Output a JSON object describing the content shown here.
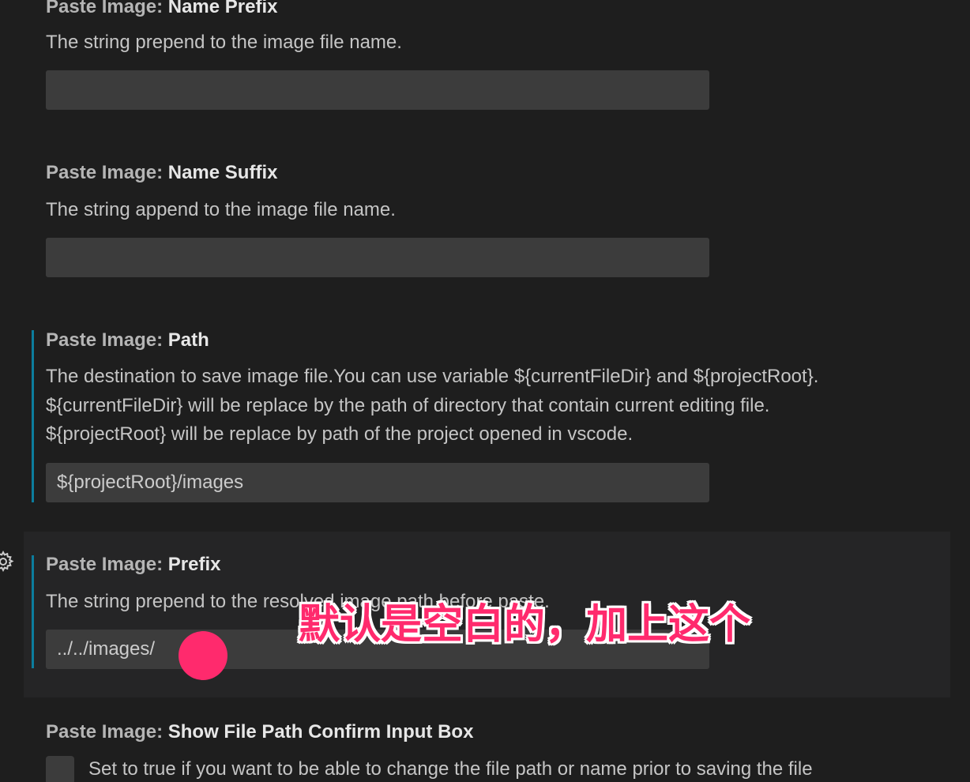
{
  "settings": [
    {
      "category": "Paste Image:",
      "key": "Name Prefix",
      "description": [
        "The string prepend to the image file name."
      ],
      "value": ""
    },
    {
      "category": "Paste Image:",
      "key": "Name Suffix",
      "description": [
        "The string append to the image file name."
      ],
      "value": ""
    },
    {
      "category": "Paste Image:",
      "key": "Path",
      "description": [
        "The destination to save image file.You can use variable ${currentFileDir} and ${projectRoot}.",
        "${currentFileDir} will be replace by the path of directory that contain current editing file.",
        "${projectRoot} will be replace by path of the project opened in vscode."
      ],
      "value": "${projectRoot}/images"
    },
    {
      "category": "Paste Image:",
      "key": "Prefix",
      "description": [
        "The string prepend to the resolved image path before paste."
      ],
      "value": "../../images/"
    },
    {
      "category": "Paste Image:",
      "key": "Show File Path Confirm Input Box",
      "description": [
        "Set to true if you want to be able to change the file path or name prior to saving the file"
      ],
      "checked": false
    }
  ],
  "annotation": {
    "text": "默认是空白的，加上这个"
  },
  "colors": {
    "background": "#1e1e1e",
    "focused_background": "#252526",
    "input_background": "#3c3c3c",
    "modified_indicator": "#0c7d9d",
    "annotation": "#ff2a6d"
  },
  "icons": {
    "settings_gear": "gear-icon"
  }
}
